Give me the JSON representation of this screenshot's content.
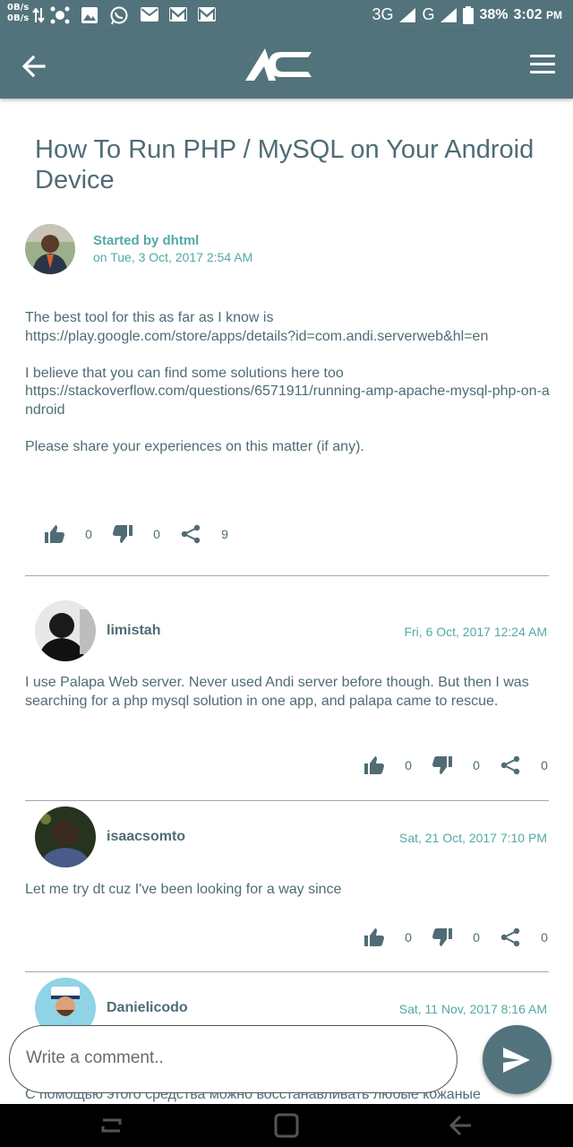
{
  "status_bar": {
    "net_up": "0B/s",
    "net_down": "0B/s",
    "network_3g": "3G",
    "network_g": "G",
    "battery": "38%",
    "time": "3:02",
    "ampm": "PM"
  },
  "app_bar": {
    "back_icon": "arrow-left-icon",
    "logo": "AC logo",
    "menu_icon": "hamburger-menu-icon"
  },
  "post": {
    "title": "How To Run PHP / MySQL on Your Android Device",
    "started_by": "Started by dhtml",
    "date": "on Tue, 3 Oct, 2017  2:54 AM",
    "body": [
      "The best tool for this as far as I know is",
      "https://play.google.com/store/apps/details?id=com.andi.serverweb&hl=en",
      "",
      "I believe that you can find some solutions here too",
      "https://stackoverflow.com/questions/6571911/running-amp-apache-mysql-php-on-android",
      "",
      "Please share your experiences on this matter (if any)."
    ],
    "likes": "0",
    "dislikes": "0",
    "shares": "9"
  },
  "comments": [
    {
      "user": "limistah",
      "date": "Fri, 6 Oct, 2017  12:24 AM",
      "text": "I use Palapa Web server. Never used Andi server before though. But then I was searching for a php mysql solution in one app, and palapa came to rescue.",
      "likes": "0",
      "dislikes": "0",
      "shares": "0"
    },
    {
      "user": "isaacsomto",
      "date": "Sat, 21 Oct, 2017  7:10 PM",
      "text": "Let me try dt cuz I've been looking for a way since",
      "likes": "0",
      "dislikes": "0",
      "shares": "0"
    },
    {
      "user": "Danielicodo",
      "date": "Sat, 11 Nov, 2017  8:16 AM",
      "text": "С помощью этого средства можно восстанавливать любые кожаные"
    }
  ],
  "composer": {
    "placeholder": "Write a comment..",
    "send_icon": "send-icon"
  },
  "colors": {
    "primary": "#52737c",
    "accent": "#52a9a4",
    "text": "#4f6c75"
  }
}
